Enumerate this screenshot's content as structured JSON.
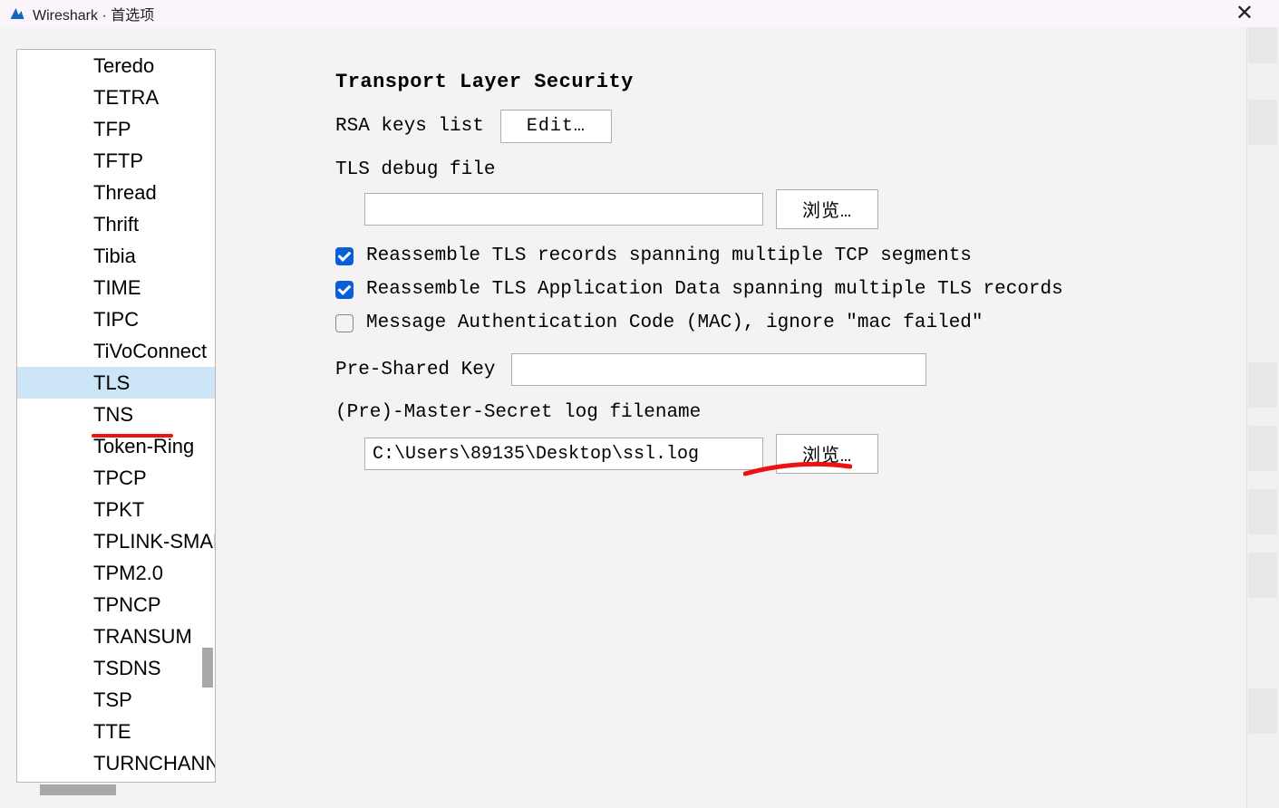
{
  "window": {
    "title": "Wireshark · 首选项"
  },
  "sidebar": {
    "items": [
      "Teredo",
      "TETRA",
      "TFP",
      "TFTP",
      "Thread",
      "Thrift",
      "Tibia",
      "TIME",
      "TIPC",
      "TiVoConnect",
      "TLS",
      "TNS",
      "Token-Ring",
      "TPCP",
      "TPKT",
      "TPLINK-SMARTHOME",
      "TPM2.0",
      "TPNCP",
      "TRANSUM",
      "TSDNS",
      "TSP",
      "TTE",
      "TURNCHANNEL"
    ],
    "selected_index": 10
  },
  "panel": {
    "heading": "Transport Layer Security",
    "rsa_label": "RSA keys list",
    "edit_btn": "Edit…",
    "debug_label": "TLS debug file",
    "debug_value": "",
    "browse_btn": "浏览…",
    "chk1_label": "Reassemble TLS records spanning multiple TCP segments",
    "chk1_checked": true,
    "chk2_label": "Reassemble TLS Application Data spanning multiple TLS records",
    "chk2_checked": true,
    "chk3_label": "Message Authentication Code (MAC), ignore \"mac failed\"",
    "chk3_checked": false,
    "psk_label": "Pre-Shared Key",
    "psk_value": "",
    "pms_label": "(Pre)-Master-Secret log filename",
    "pms_value": "C:\\Users\\89135\\Desktop\\ssl.log"
  }
}
